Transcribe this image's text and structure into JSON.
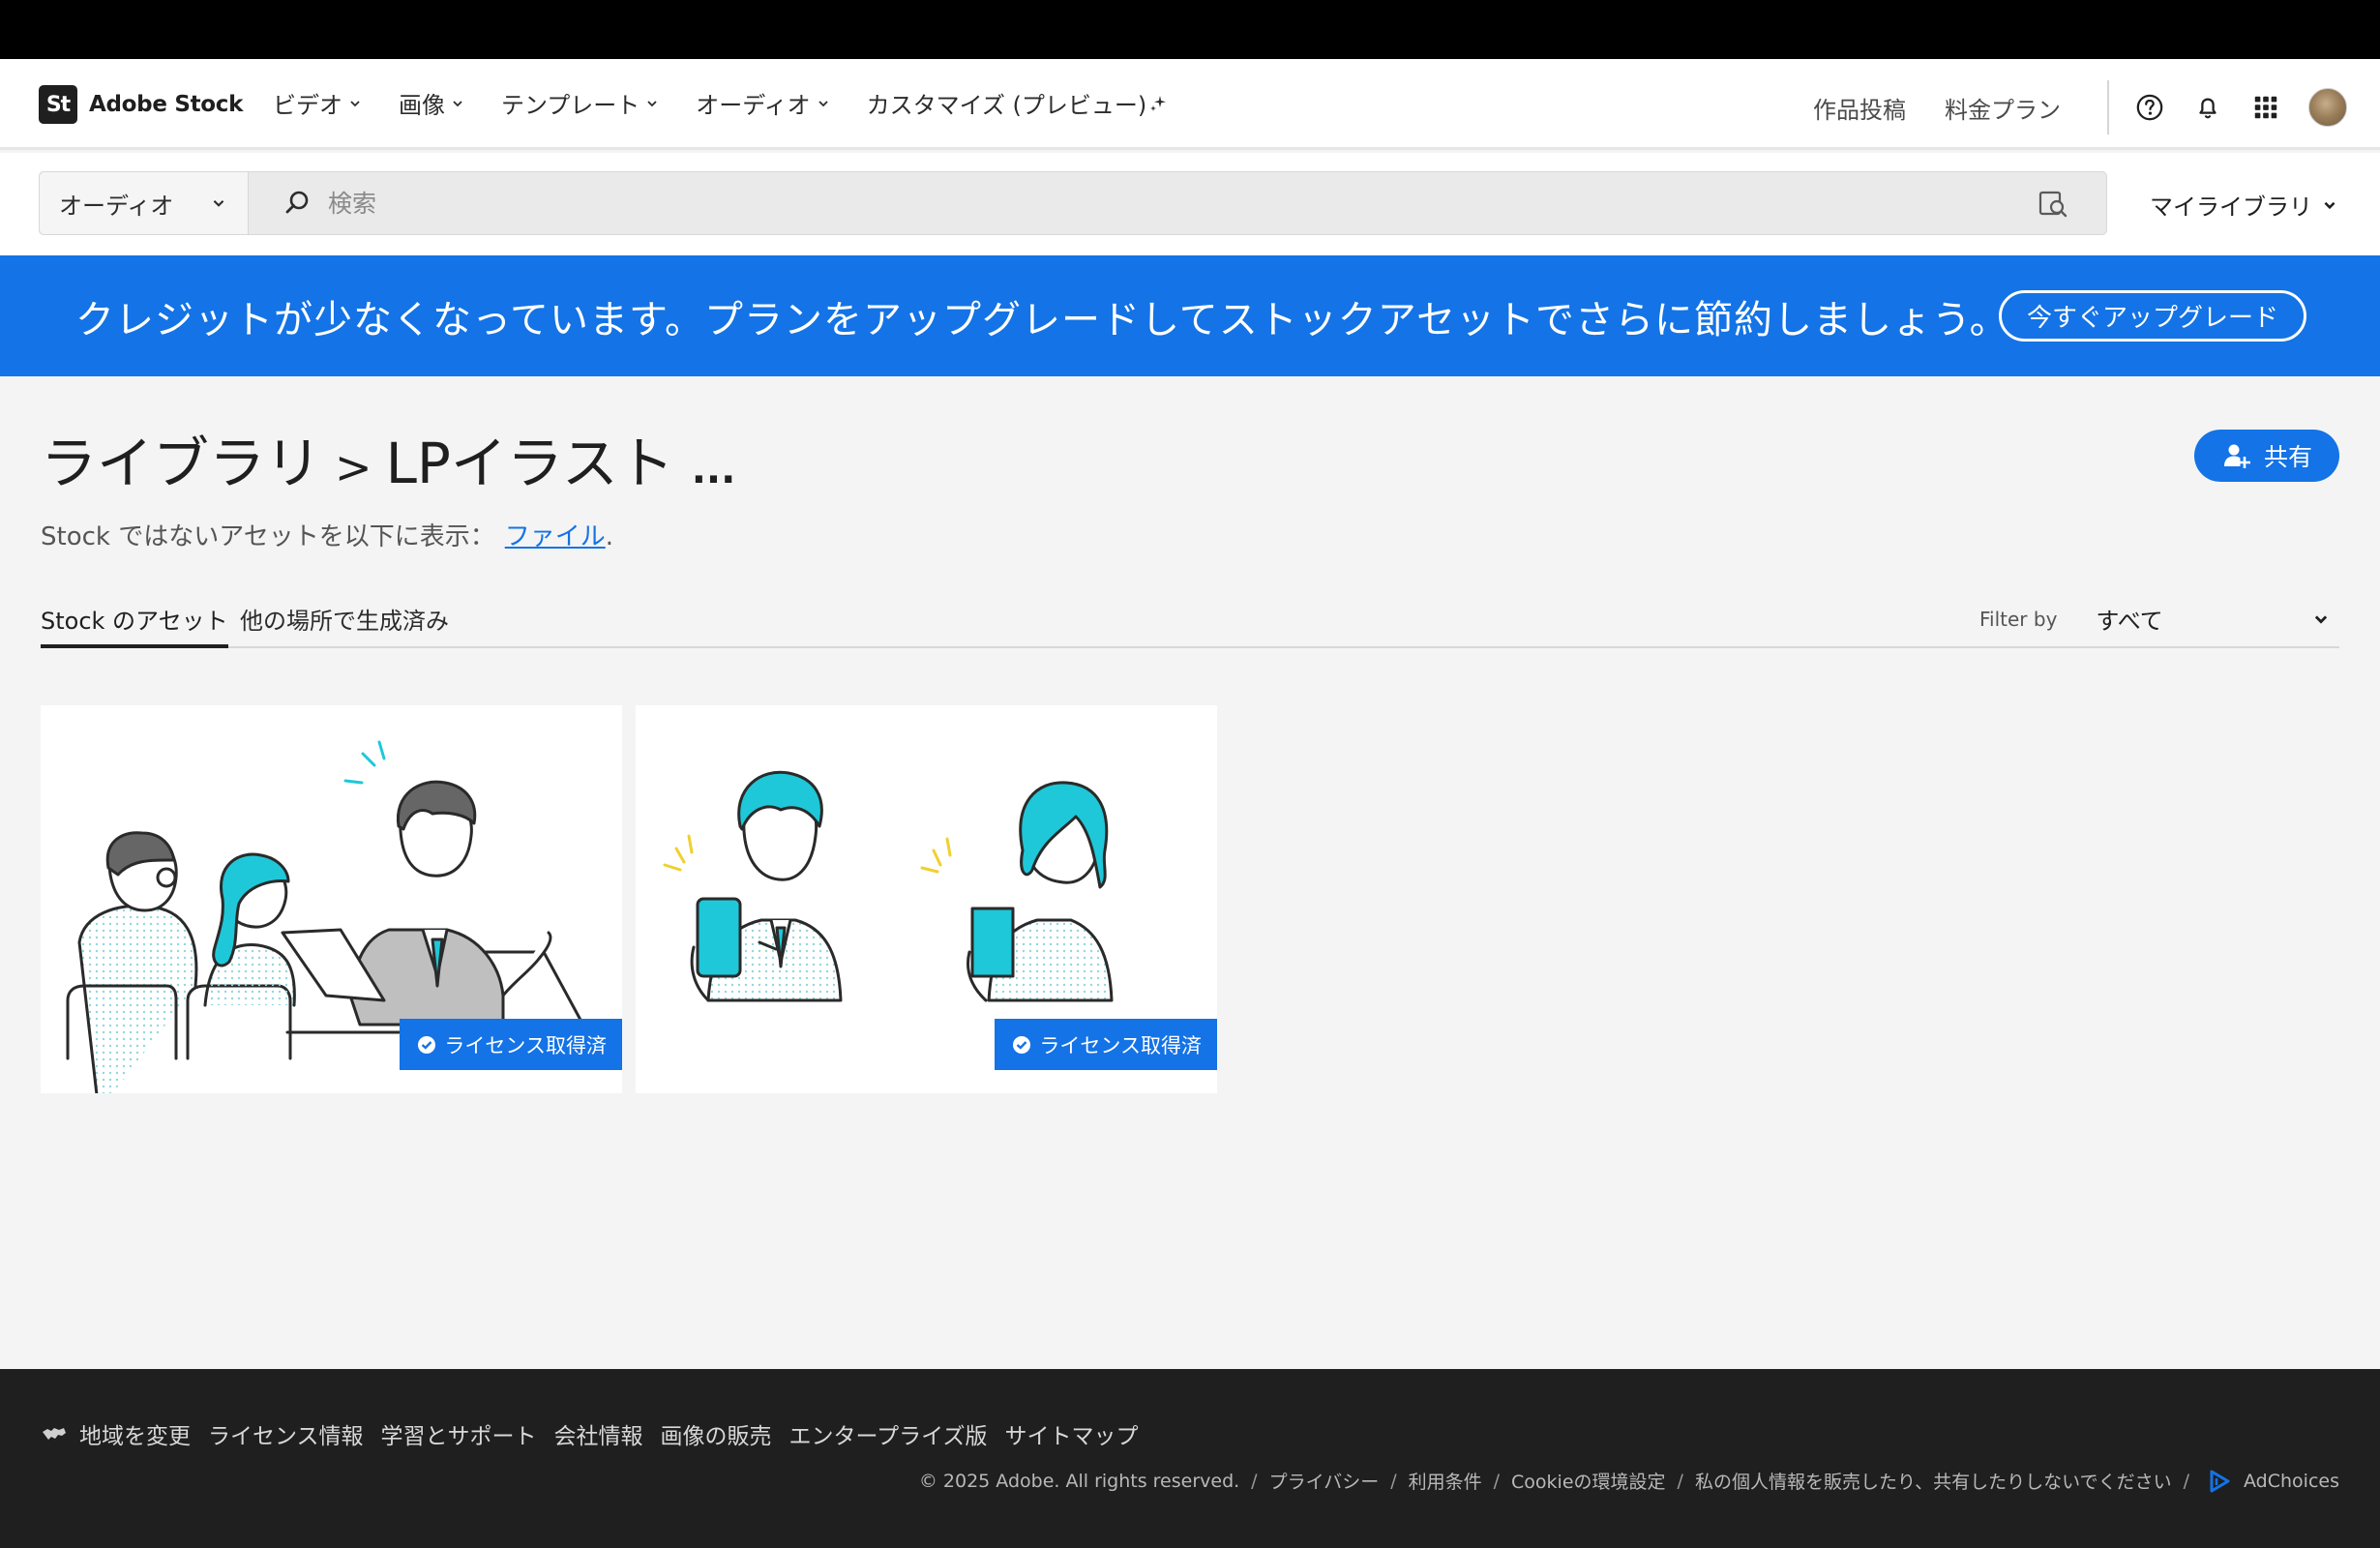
{
  "header": {
    "logo_mark": "St",
    "logo_text": "Adobe Stock",
    "nav": [
      {
        "label": "ビデオ"
      },
      {
        "label": "画像"
      },
      {
        "label": "テンプレート"
      },
      {
        "label": "オーディオ"
      },
      {
        "label": "カスタマイズ (プレビュー)"
      }
    ],
    "links": [
      "作品投稿",
      "料金プラン"
    ],
    "icons": [
      "help-icon",
      "bell-icon",
      "apps-grid-icon"
    ]
  },
  "search": {
    "scope": "オーディオ",
    "placeholder": "検索",
    "my_library": "マイライブラリ"
  },
  "banner": {
    "text": "クレジットが少なくなっています。プランをアップグレードしてストックアセットでさらに節約しましょう。",
    "button": "今すぐアップグレード",
    "color": "#1473e6"
  },
  "page": {
    "breadcrumb_root": "ライブラリ",
    "separator": ">",
    "library_name": "LPイラスト",
    "more": "...",
    "share": "共有",
    "subtitle_prefix": "Stock ではないアセットを以下に表示：",
    "subtitle_link": "ファイル",
    "subtitle_suffix": "."
  },
  "tabs": [
    {
      "label": "Stock のアセット",
      "active": true
    },
    {
      "label": "他の場所で生成済み",
      "active": false
    }
  ],
  "filter": {
    "label": "Filter by",
    "value": "すべて"
  },
  "assets": [
    {
      "badge": "ライセンス取得済",
      "illustration": "business-meeting-illustration"
    },
    {
      "badge": "ライセンス取得済",
      "illustration": "people-holding-smartphones-illustration"
    }
  ],
  "footer": {
    "links": [
      "地域を変更",
      "ライセンス情報",
      "学習とサポート",
      "会社情報",
      "画像の販売",
      "エンタープライズ版",
      "サイトマップ"
    ],
    "copyright": "© 2025 Adobe. All rights reserved.",
    "legal": [
      "プライバシー",
      "利用条件",
      "Cookieの環境設定",
      "私の個人情報を販売したり、共有したりしないでください"
    ],
    "adchoices": "AdChoices"
  },
  "colors": {
    "accent": "#1473e6",
    "illustration_teal": "#1ec8d8",
    "footer_bg": "#1f1f1f"
  }
}
